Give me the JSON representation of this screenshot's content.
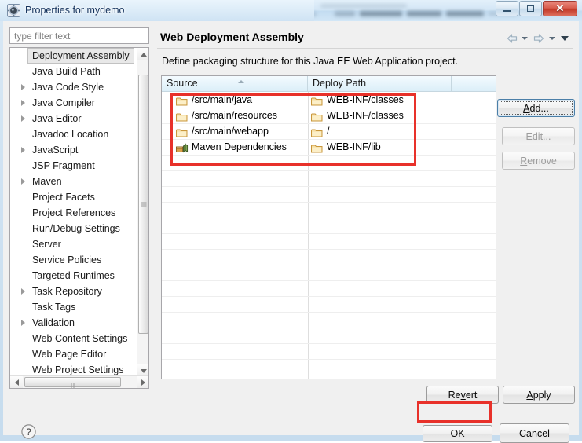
{
  "window": {
    "title": "Properties for mydemo",
    "icon": "properties-gear-icon",
    "minimize_label": "Minimize",
    "maximize_label": "Maximize",
    "close_label": "Close"
  },
  "sidebar": {
    "filter": {
      "placeholder": "type filter text",
      "value": ""
    },
    "items": [
      {
        "label": "Deployment Assembly",
        "expandable": false,
        "selected": true
      },
      {
        "label": "Java Build Path",
        "expandable": false,
        "selected": false
      },
      {
        "label": "Java Code Style",
        "expandable": true,
        "selected": false
      },
      {
        "label": "Java Compiler",
        "expandable": true,
        "selected": false
      },
      {
        "label": "Java Editor",
        "expandable": true,
        "selected": false
      },
      {
        "label": "Javadoc Location",
        "expandable": false,
        "selected": false
      },
      {
        "label": "JavaScript",
        "expandable": true,
        "selected": false
      },
      {
        "label": "JSP Fragment",
        "expandable": false,
        "selected": false
      },
      {
        "label": "Maven",
        "expandable": true,
        "selected": false
      },
      {
        "label": "Project Facets",
        "expandable": false,
        "selected": false
      },
      {
        "label": "Project References",
        "expandable": false,
        "selected": false
      },
      {
        "label": "Run/Debug Settings",
        "expandable": false,
        "selected": false
      },
      {
        "label": "Server",
        "expandable": false,
        "selected": false
      },
      {
        "label": "Service Policies",
        "expandable": false,
        "selected": false
      },
      {
        "label": "Targeted Runtimes",
        "expandable": false,
        "selected": false
      },
      {
        "label": "Task Repository",
        "expandable": true,
        "selected": false
      },
      {
        "label": "Task Tags",
        "expandable": false,
        "selected": false
      },
      {
        "label": "Validation",
        "expandable": true,
        "selected": false
      },
      {
        "label": "Web Content Settings",
        "expandable": false,
        "selected": false
      },
      {
        "label": "Web Page Editor",
        "expandable": false,
        "selected": false
      },
      {
        "label": "Web Project Settings",
        "expandable": false,
        "selected": false
      }
    ]
  },
  "page": {
    "title": "Web Deployment Assembly",
    "description": "Define packaging structure for this Java EE Web Application project.",
    "nav": {
      "back_icon": "back-arrow-icon",
      "back_menu_icon": "chevron-down-icon",
      "forward_icon": "forward-arrow-icon",
      "forward_menu_icon": "chevron-down-icon",
      "menu_icon": "chevron-down-icon"
    }
  },
  "table": {
    "columns": [
      "Source",
      "Deploy Path",
      ""
    ],
    "sort_column": "Source",
    "rows": [
      {
        "icon": "folder-icon",
        "source": "/src/main/java",
        "deploy_icon": "folder-icon",
        "deploy": "WEB-INF/classes"
      },
      {
        "icon": "folder-icon",
        "source": "/src/main/resources",
        "deploy_icon": "folder-icon",
        "deploy": "WEB-INF/classes"
      },
      {
        "icon": "folder-icon",
        "source": "/src/main/webapp",
        "deploy_icon": "folder-icon",
        "deploy": "/"
      },
      {
        "icon": "maven-icon",
        "source": "Maven Dependencies",
        "deploy_icon": "folder-icon",
        "deploy": "WEB-INF/lib"
      }
    ]
  },
  "buttons": {
    "add": "Add...",
    "edit": "Edit...",
    "remove": "Remove",
    "revert": "Revert",
    "apply": "Apply",
    "ok": "OK",
    "cancel": "Cancel"
  },
  "footer": {
    "help_icon": "help-question-icon"
  },
  "colors": {
    "annotation": "#e8312a",
    "accent": "#4b7fa8",
    "folder": "#f3d08a",
    "header_gradient_top": "#f4fbff",
    "header_gradient_bottom": "#dbeef8",
    "title_text": "#14325c"
  },
  "annotations": [
    {
      "name": "table-rows-highlight",
      "color": "#e8312a"
    },
    {
      "name": "ok-button-highlight",
      "color": "#e8312a"
    }
  ]
}
